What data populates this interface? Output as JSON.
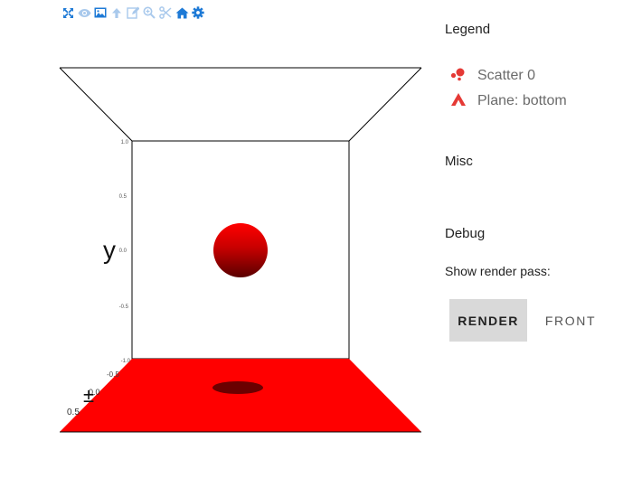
{
  "toolbar": {
    "icons": [
      "expand-icon",
      "eye-icon",
      "image-icon",
      "arrow-up-icon",
      "edit-icon",
      "zoom-icon",
      "scissors-icon",
      "home-icon",
      "gear-icon"
    ]
  },
  "scene": {
    "axis_label_y": "y",
    "y_ticks": [
      "1.0",
      "0.5",
      "0.0",
      "-0.5",
      "-1.0"
    ],
    "z_ticks": [
      "-0.5",
      "0.0",
      "0.5"
    ],
    "colors": {
      "floor": "#ff0000",
      "sphere_top": "#ff0000",
      "sphere_bottom": "#5a0000",
      "shadow": "#6b0000",
      "lines": "#000000"
    }
  },
  "panel": {
    "legend_title": "Legend",
    "legend_items": [
      {
        "label": "Scatter 0",
        "icon": "scatter-icon",
        "color": "#e53935"
      },
      {
        "label": "Plane: bottom",
        "icon": "triangle-plane-icon",
        "color": "#e53935"
      }
    ],
    "misc_title": "Misc",
    "debug_title": "Debug",
    "render_pass_label": "Show render pass:",
    "buttons": {
      "render": "RENDER",
      "front": "FRONT"
    }
  }
}
